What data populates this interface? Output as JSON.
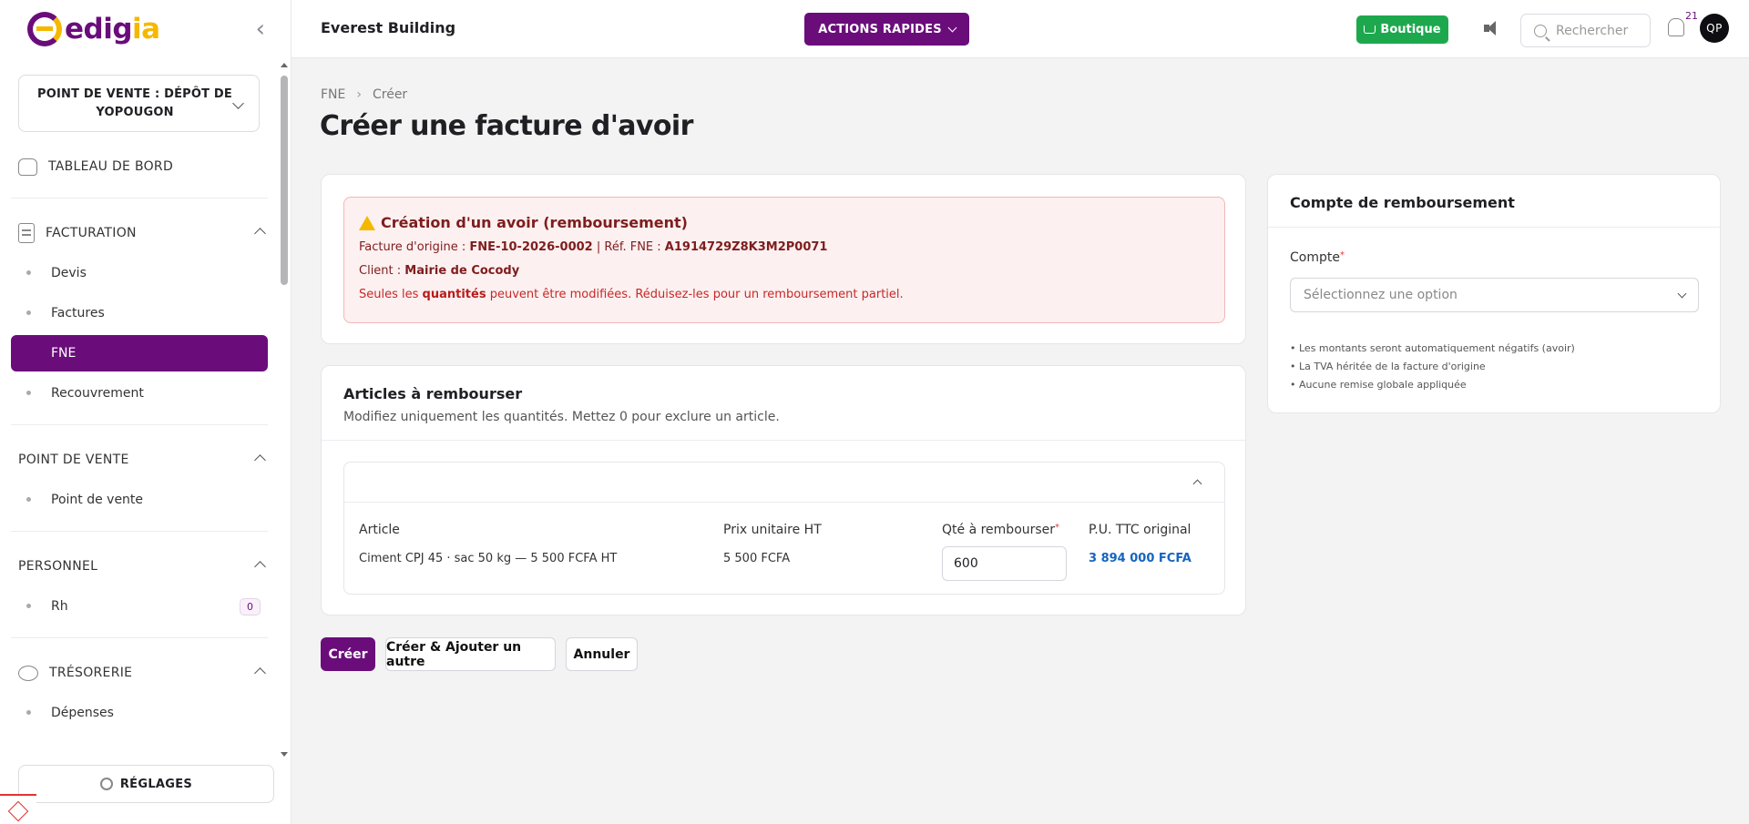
{
  "app": {
    "logo_main": "edig",
    "logo_accent": "ia",
    "company": "Everest Building",
    "quick_actions": "ACTIONS RAPIDES",
    "shop": "Boutique",
    "search_placeholder": "Rechercher",
    "notifications_count": "21",
    "avatar_initials": "QP"
  },
  "sidebar": {
    "point_of_sale": "POINT DE VENTE : DÉPÔT DE YOPOUGON",
    "dashboard": "TABLEAU DE BORD",
    "sections": [
      {
        "title": "FACTURATION",
        "items": [
          "Devis",
          "Factures",
          "FNE",
          "Recouvrement"
        ]
      },
      {
        "title": "POINT DE VENTE",
        "items": [
          "Point de vente"
        ]
      },
      {
        "title": "PERSONNEL",
        "items": [
          "Rh"
        ],
        "badge": "0"
      },
      {
        "title": "TRÉSORERIE",
        "items": [
          "Dépenses"
        ]
      }
    ],
    "active_item": "FNE",
    "settings": "RÉGLAGES"
  },
  "breadcrumb": [
    "FNE",
    "Créer"
  ],
  "page_title": "Créer une facture d'avoir",
  "alert": {
    "title": "Création d'un avoir (remboursement)",
    "origin_label": "Facture d'origine :",
    "origin_value": "FNE-10-2026-0002",
    "ref_separator": "|",
    "ref_label": "Réf. FNE :",
    "ref_value": "A1914729Z8K3M2P0071",
    "client_label": "Client :",
    "client_value": "Mairie de Cocody",
    "note_before": "Seules les",
    "note_bold": "quantités",
    "note_after": "peuvent être modifiées. Réduisez-les pour un remboursement partiel."
  },
  "articles": {
    "title": "Articles à rembourser",
    "subtitle": "Modifiez uniquement les quantités. Mettez 0 pour exclure un article.",
    "columns": [
      "Article",
      "Prix unitaire HT",
      "Qté à rembourser",
      "P.U. TTC original"
    ],
    "rows": [
      {
        "article": "Ciment CPJ 45 · sac 50 kg — 5 500 FCFA HT",
        "unit_price": "5 500 FCFA",
        "qty": "600",
        "ttc": "3 894 000 FCFA"
      }
    ]
  },
  "buttons": {
    "create": "Créer",
    "create_another": "Créer & Ajouter un autre",
    "cancel": "Annuler"
  },
  "refund_account": {
    "title": "Compte de remboursement",
    "field_label": "Compte",
    "placeholder": "Sélectionnez une option",
    "hints": [
      "• Les montants seront automatiquement négatifs (avoir)",
      "• La TVA héritée de la facture d'origine",
      "• Aucune remise globale appliquée"
    ]
  },
  "colors": {
    "brand": "#6a0d7b",
    "accent": "#f5b800",
    "shop": "#1ea84e",
    "link": "#1565c0"
  }
}
